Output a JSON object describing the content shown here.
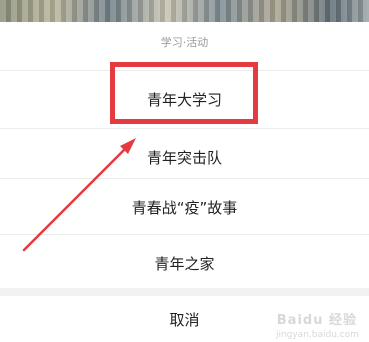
{
  "sheet": {
    "title": "学习·活动"
  },
  "menu": {
    "items": [
      {
        "label": "青年大学习"
      },
      {
        "label": "青年突击队"
      },
      {
        "label": "青春战“疫”故事"
      },
      {
        "label": "青年之家"
      }
    ],
    "cancel_label": "取消"
  },
  "annotation": {
    "color": "#e53a3f"
  },
  "watermark": {
    "text": "Baidu 经验",
    "sub": "jingyan.baidu.com"
  }
}
